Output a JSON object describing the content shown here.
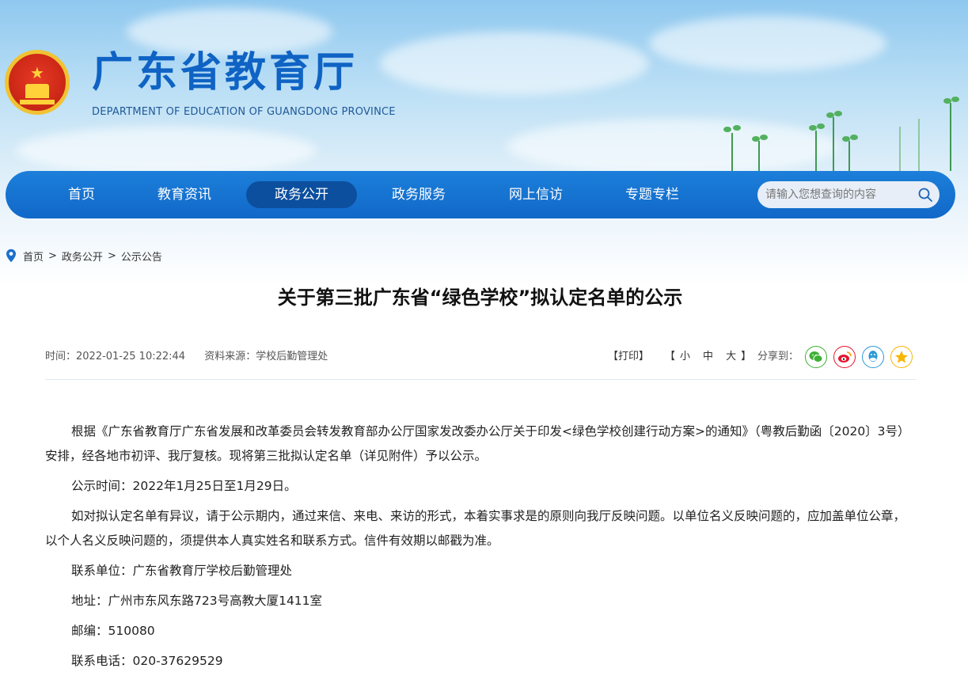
{
  "header": {
    "site_title": "广东省教育厅",
    "site_subtitle": "DEPARTMENT OF EDUCATION OF GUANGDONG PROVINCE",
    "emblem_icon": "national-emblem-icon"
  },
  "nav": {
    "items": [
      {
        "label": "首页"
      },
      {
        "label": "教育资讯"
      },
      {
        "label": "政务公开",
        "active": true
      },
      {
        "label": "政务服务"
      },
      {
        "label": "网上信访"
      },
      {
        "label": "专题专栏"
      }
    ],
    "search_placeholder": "请输入您想查询的内容",
    "search_icon": "search-icon"
  },
  "breadcrumb": {
    "items": [
      "首页",
      "政务公开",
      "公示公告"
    ],
    "separator": ">"
  },
  "article": {
    "title": "关于第三批广东省“绿色学校”拟认定名单的公示",
    "time_label": "时间：2022-01-25 10:22:44",
    "source_label": "资料来源：学校后勤管理处",
    "print_label": "【打印】",
    "font_size": {
      "open": "【",
      "small": "小",
      "medium": "中",
      "large": "大",
      "close": "】"
    },
    "share_label": "分享到：",
    "share_icons": [
      "wechat-icon",
      "weibo-icon",
      "qq-icon",
      "qzone-icon"
    ],
    "paragraphs": [
      "根据《广东省教育厅广东省发展和改革委员会转发教育部办公厅国家发改委办公厅关于印发<绿色学校创建行动方案>的通知》（粤教后勤函〔2020〕3号）安排，经各地市初评、我厅复核。现将第三批拟认定名单（详见附件）予以公示。",
      "公示时间：2022年1月25日至1月29日。",
      "如对拟认定名单有异议，请于公示期内，通过来信、来电、来访的形式，本着实事求是的原则向我厅反映问题。以单位名义反映问题的，应加盖单位公章，以个人名义反映问题的，须提供本人真实姓名和联系方式。信件有效期以邮戳为准。",
      "联系单位：广东省教育厅学校后勤管理处",
      "地址：广州市东风东路723号高教大厦1411室",
      "邮编：510080",
      "联系电话：020-37629529"
    ]
  },
  "colors": {
    "nav_bg": "#1168c8",
    "nav_active": "#0c4f9e",
    "title_blue": "#0f63c4",
    "wechat": "#3cb034",
    "weibo": "#e6162d",
    "qq": "#2a9bd8",
    "qzone": "#f7b500"
  }
}
